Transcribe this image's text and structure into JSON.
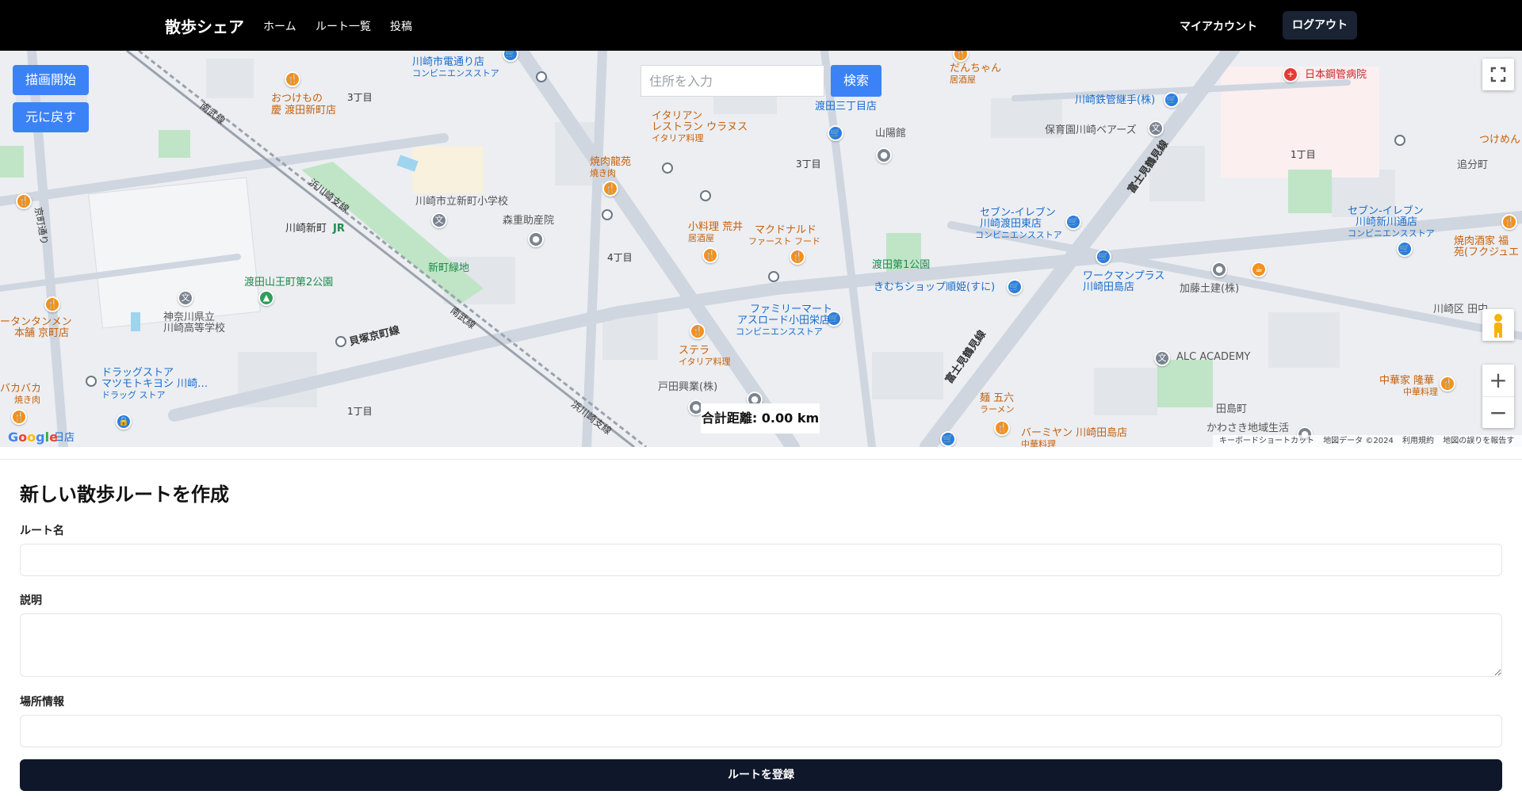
{
  "header": {
    "brand": "散歩シェア",
    "nav": [
      "ホーム",
      "ルート一覧",
      "投稿"
    ],
    "account": "マイアカウント",
    "logout": "ログアウト"
  },
  "map": {
    "draw_start": "描画開始",
    "undo": "元に戻す",
    "address_placeholder": "住所を入力",
    "search": "検索",
    "total_distance": "合計距離: 0.00 km",
    "google_logo": "Google",
    "attribution": [
      "キーボードショートカット",
      "地図データ ©2024",
      "利用規約",
      "地図の誤りを報告する"
    ],
    "labels": {
      "l1": "おつけもの",
      "l2": "慶 渡田新町店",
      "l3": "3丁目",
      "l4": "川崎市電通り店",
      "l5": "コンビニエンスストア",
      "l6": "イタリアン",
      "l7": "レストラン ウラヌス",
      "l8": "イタリア料理",
      "l9": "焼肉龍苑",
      "l10": "焼き肉",
      "l11": "渡田三丁目店",
      "l12": "山陽館",
      "l13": "3丁目",
      "l14": "だんちゃん",
      "l15": "居酒屋",
      "l16": "日本鋼管病院",
      "l17": "川崎鉄管継手(株)",
      "l18": "保育園川崎ベアーズ",
      "l19": "富士見鶴見線",
      "l20": "1丁目",
      "l21": "追分町",
      "l22": "つけめん",
      "l23": "南武線",
      "l24": "浜川崎支線",
      "l25": "京町通り",
      "l26": "川崎市立新町小学校",
      "l27": "森重助産院",
      "l28": "川崎新町",
      "l29": "JR",
      "l30": "新町緑地",
      "l31": "4丁目",
      "l32": "小料理 荒井",
      "l33": "居酒屋",
      "l34": "マクドナルド",
      "l35": "ファースト フード",
      "l36": "渡田第1公園",
      "l37": "きむちショップ順姫(すに)",
      "l38": "セブン-イレブン",
      "l39": "川崎渡田東店",
      "l40": "コンビニエンスストア",
      "l41": "ワークマンプラス",
      "l42": "川崎田島店",
      "l43": "加藤土建(株)",
      "l44": "セブン-イレブン",
      "l45": "川崎新川通店",
      "l46": "コンビニエンスストア",
      "l47": "焼肉酒家 福",
      "l48": "苑(フクジュエ",
      "l49": "渡田山王町第2公園",
      "l50": "神奈川県立",
      "l51": "川崎高等学校",
      "l52": "ータンタンメン",
      "l53": "本舗 京町店",
      "l54": "貝塚京町線",
      "l55": "ファミリーマート",
      "l56": "アスロード小田栄店",
      "l57": "コンビニエンスストア",
      "l58": "ステラ",
      "l59": "イタリア料理",
      "l60": "川崎区 田中",
      "l61": "ALC ACADEMY",
      "l62": "中華家 隆華",
      "l63": "中華料理",
      "l64": "ドラッグストア",
      "l65": "マツモトキヨシ 川崎…",
      "l66": "ドラッグ ストア",
      "l67": "バカバカ",
      "l68": "焼き肉",
      "l69": "戸田興業(株)",
      "l70": "1丁目",
      "l71": "麺 五六",
      "l72": "ラーメン",
      "l73": "バーミヤン 川崎田島店",
      "l74": "中華料理",
      "l75": "田島町",
      "l76": "かわさき地域生活",
      "l77": "富士見鶴見線",
      "l78": "南武線",
      "l79": "浜川崎支線",
      "l80": "日店"
    }
  },
  "form": {
    "title": "新しい散歩ルートを作成",
    "route_name_label": "ルート名",
    "route_name_value": "",
    "description_label": "説明",
    "description_value": "",
    "location_label": "場所情報",
    "location_value": "",
    "submit": "ルートを登録"
  }
}
